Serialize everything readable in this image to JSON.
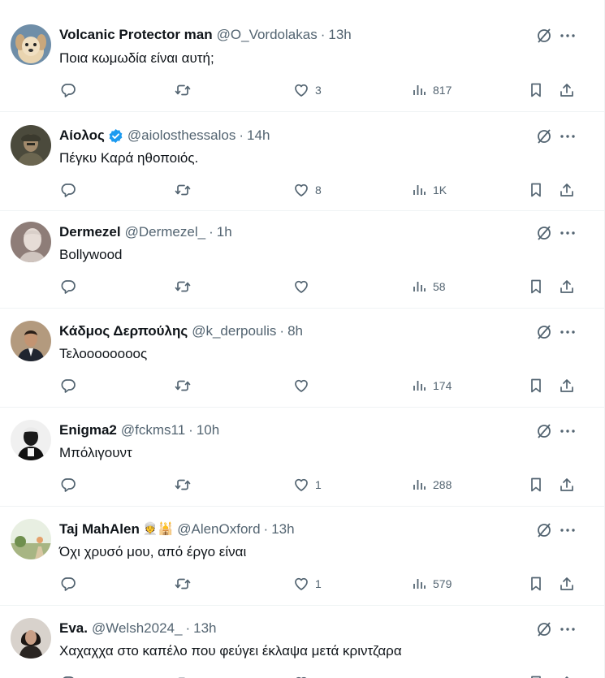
{
  "tweets": [
    {
      "name": "Volcanic Protector man",
      "handle": "@O_Vordolakas",
      "time": "13h",
      "text": "Ποια κωμωδία είναι αυτή;",
      "likes": "3",
      "views": "817",
      "verified": false,
      "avatar": "dog-avatar"
    },
    {
      "name": "Αίολος",
      "handle": "@aiolosthessalos",
      "time": "14h",
      "text": "Πέγκυ Καρά ηθοποιός.",
      "likes": "8",
      "views": "1K",
      "verified": true,
      "avatar": "soldier-avatar"
    },
    {
      "name": "Dermezel",
      "handle": "@Dermezel_",
      "time": "1h",
      "text": "Bollywood",
      "likes": "",
      "views": "58",
      "verified": false,
      "avatar": "android-avatar"
    },
    {
      "name": "Κάδμος Δερπούλης",
      "handle": "@k_derpoulis",
      "time": "8h",
      "text": "Τελοοοοοοοος",
      "likes": "",
      "views": "174",
      "verified": false,
      "avatar": "suit-man-avatar"
    },
    {
      "name": "Enigma2",
      "handle": "@fckms11",
      "time": "10h",
      "text": "Μπόλιγουντ",
      "likes": "1",
      "views": "288",
      "verified": false,
      "avatar": "silhouette-avatar"
    },
    {
      "name": "Taj MahAlen",
      "emoji": "👳🕌",
      "handle": "@AlenOxford",
      "time": "13h",
      "text": "Όχι χρυσό μου, από έργο είναι",
      "likes": "1",
      "views": "579",
      "verified": false,
      "avatar": "landscape-avatar"
    },
    {
      "name": "Eva.",
      "handle": "@Welsh2024_",
      "time": "13h",
      "text": "Χαχαχχα στο καπέλο που φεύγει έκλαψα μετά κριντζαρα",
      "likes": "",
      "views": "",
      "verified": false,
      "avatar": "woman-avatar"
    }
  ],
  "separator": "·",
  "colors": {
    "text": "#0f1419",
    "secondary": "#536471",
    "verified": "#1d9bf0",
    "border": "#eff3f4"
  }
}
